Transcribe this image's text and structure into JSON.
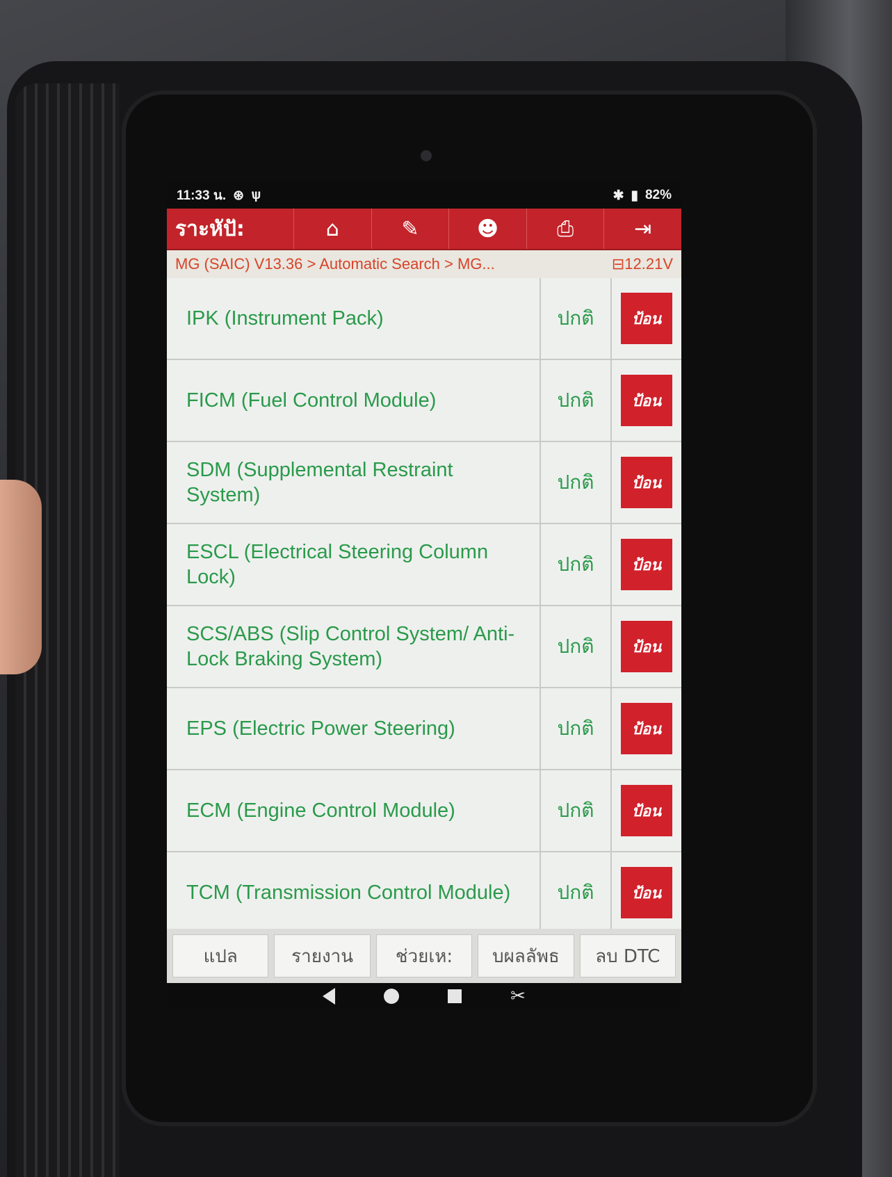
{
  "status_bar": {
    "time": "11:33 น.",
    "battery": "82%"
  },
  "toolbar": {
    "title": "ราะหัปั:",
    "icons": [
      "home-icon",
      "edit-icon",
      "user-icon",
      "print-icon",
      "exit-icon"
    ]
  },
  "breadcrumb": {
    "path": "MG (SAIC) V13.36 > Automatic Search > MG...",
    "voltage": "12.21V"
  },
  "systems": [
    {
      "name": "IPK (Instrument Pack)",
      "status": "ปกติ",
      "action": "ป้อน"
    },
    {
      "name": "FICM (Fuel Control Module)",
      "status": "ปกติ",
      "action": "ป้อน"
    },
    {
      "name": "SDM (Supplemental Restraint System)",
      "status": "ปกติ",
      "action": "ป้อน"
    },
    {
      "name": "ESCL (Electrical Steering Column Lock)",
      "status": "ปกติ",
      "action": "ป้อน"
    },
    {
      "name": "SCS/ABS (Slip Control System/ Anti-Lock Braking System)",
      "status": "ปกติ",
      "action": "ป้อน"
    },
    {
      "name": "EPS (Electric Power Steering)",
      "status": "ปกติ",
      "action": "ป้อน"
    },
    {
      "name": "ECM (Engine Control Module)",
      "status": "ปกติ",
      "action": "ป้อน"
    },
    {
      "name": "TCM (Transmission Control Module)",
      "status": "ปกติ",
      "action": "ป้อน"
    }
  ],
  "footer": {
    "buttons": [
      "แปล",
      "รายงาน",
      "ช่วยเห:",
      "บผลลัพธ",
      "ลบ DTC"
    ]
  },
  "colors": {
    "accent": "#c3232a",
    "text_green": "#2a9a4a",
    "breadcrumb": "#d8432a"
  }
}
